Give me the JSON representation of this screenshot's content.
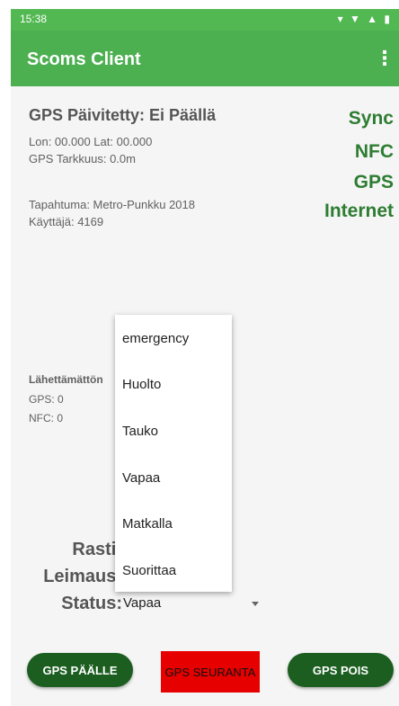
{
  "statusbar": {
    "time": "15:38",
    "icons": "▾ ▼ ▲ ▮"
  },
  "appbar": {
    "title": "Scoms Client",
    "menu_icon": "⋮"
  },
  "gps": {
    "title": "GPS Päivitetty: Ei Päällä",
    "coords": "Lon: 00.000 Lat: 00.000",
    "accuracy": "GPS Tarkkuus: 0.0m"
  },
  "event": {
    "name": "Tapahtuma: Metro-Punkku 2018",
    "user": "Käyttäjä: 4169"
  },
  "sync": {
    "sync": "Sync",
    "nfc": "NFC",
    "gps": "GPS",
    "internet": "Internet"
  },
  "unsent": {
    "label": "Lähettämättön",
    "gps": "GPS: 0",
    "nfc": "NFC: 0"
  },
  "dropdown": {
    "options": [
      "emergency",
      "Huolto",
      "Tauko",
      "Vapaa",
      "Matkalla",
      "Suorittaa"
    ]
  },
  "fields": {
    "rasti": "Rasti:",
    "leimaus": "Leimaus:",
    "status": "Status:",
    "status_value": "Vapaa"
  },
  "buttons": {
    "gps_on": "GPS PÄÄLLE",
    "gps_track": "GPS SEURANTA",
    "gps_off": "GPS POIS"
  },
  "colors": {
    "appbar": "#4caf50",
    "sync_text": "#2e7d32",
    "button": "#1b5e20",
    "tracking_button": "#e60000"
  }
}
